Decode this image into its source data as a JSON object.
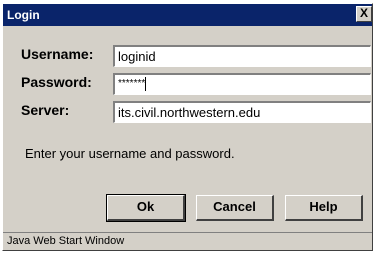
{
  "window": {
    "title": "Login",
    "close_label": "X"
  },
  "form": {
    "username_label": "Username:",
    "username_value": "loginid",
    "password_label": "Password:",
    "password_value": "*******",
    "server_label": "Server:",
    "server_value": "its.civil.northwestern.edu"
  },
  "message": "Enter your username and password.",
  "buttons": {
    "ok_label": "Ok",
    "cancel_label": "Cancel",
    "help_label": "Help"
  },
  "status_bar": "Java Web Start Window",
  "colors": {
    "titlebar": "#0a246a",
    "window_bg": "#d4d0c8"
  }
}
